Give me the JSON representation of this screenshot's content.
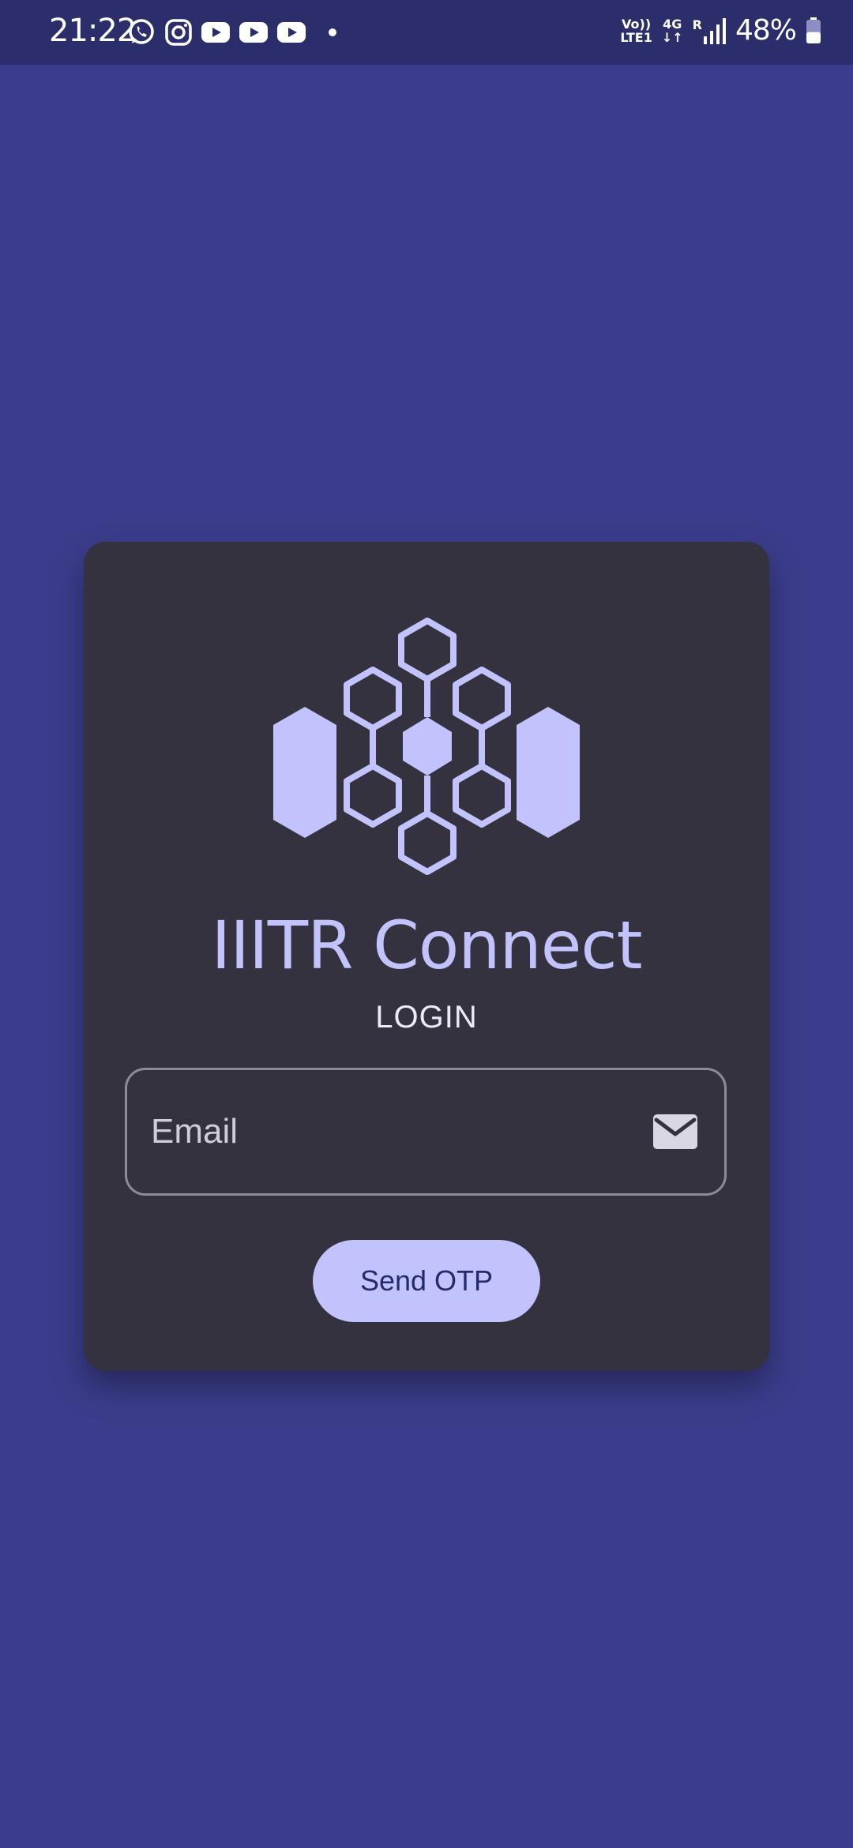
{
  "status_bar": {
    "time": "21:22",
    "notification_icons": [
      "whatsapp-icon",
      "instagram-icon",
      "youtube-icon",
      "youtube-icon",
      "youtube-icon"
    ],
    "volte_top": "Vo))",
    "volte_bottom": "LTE1",
    "network_type": "4G",
    "roaming": "R",
    "battery_percent": "48%",
    "battery_level": 0.48
  },
  "login_card": {
    "app_title": "IIITR Connect",
    "subtitle": "LOGIN",
    "email_placeholder": "Email",
    "email_value": "",
    "send_button_label": "Send OTP"
  },
  "colors": {
    "background": "#3b3d8c",
    "status_bar": "#2b2e6b",
    "card": "#34323e",
    "accent": "#c2c2fc",
    "button_text": "#252a6e"
  }
}
